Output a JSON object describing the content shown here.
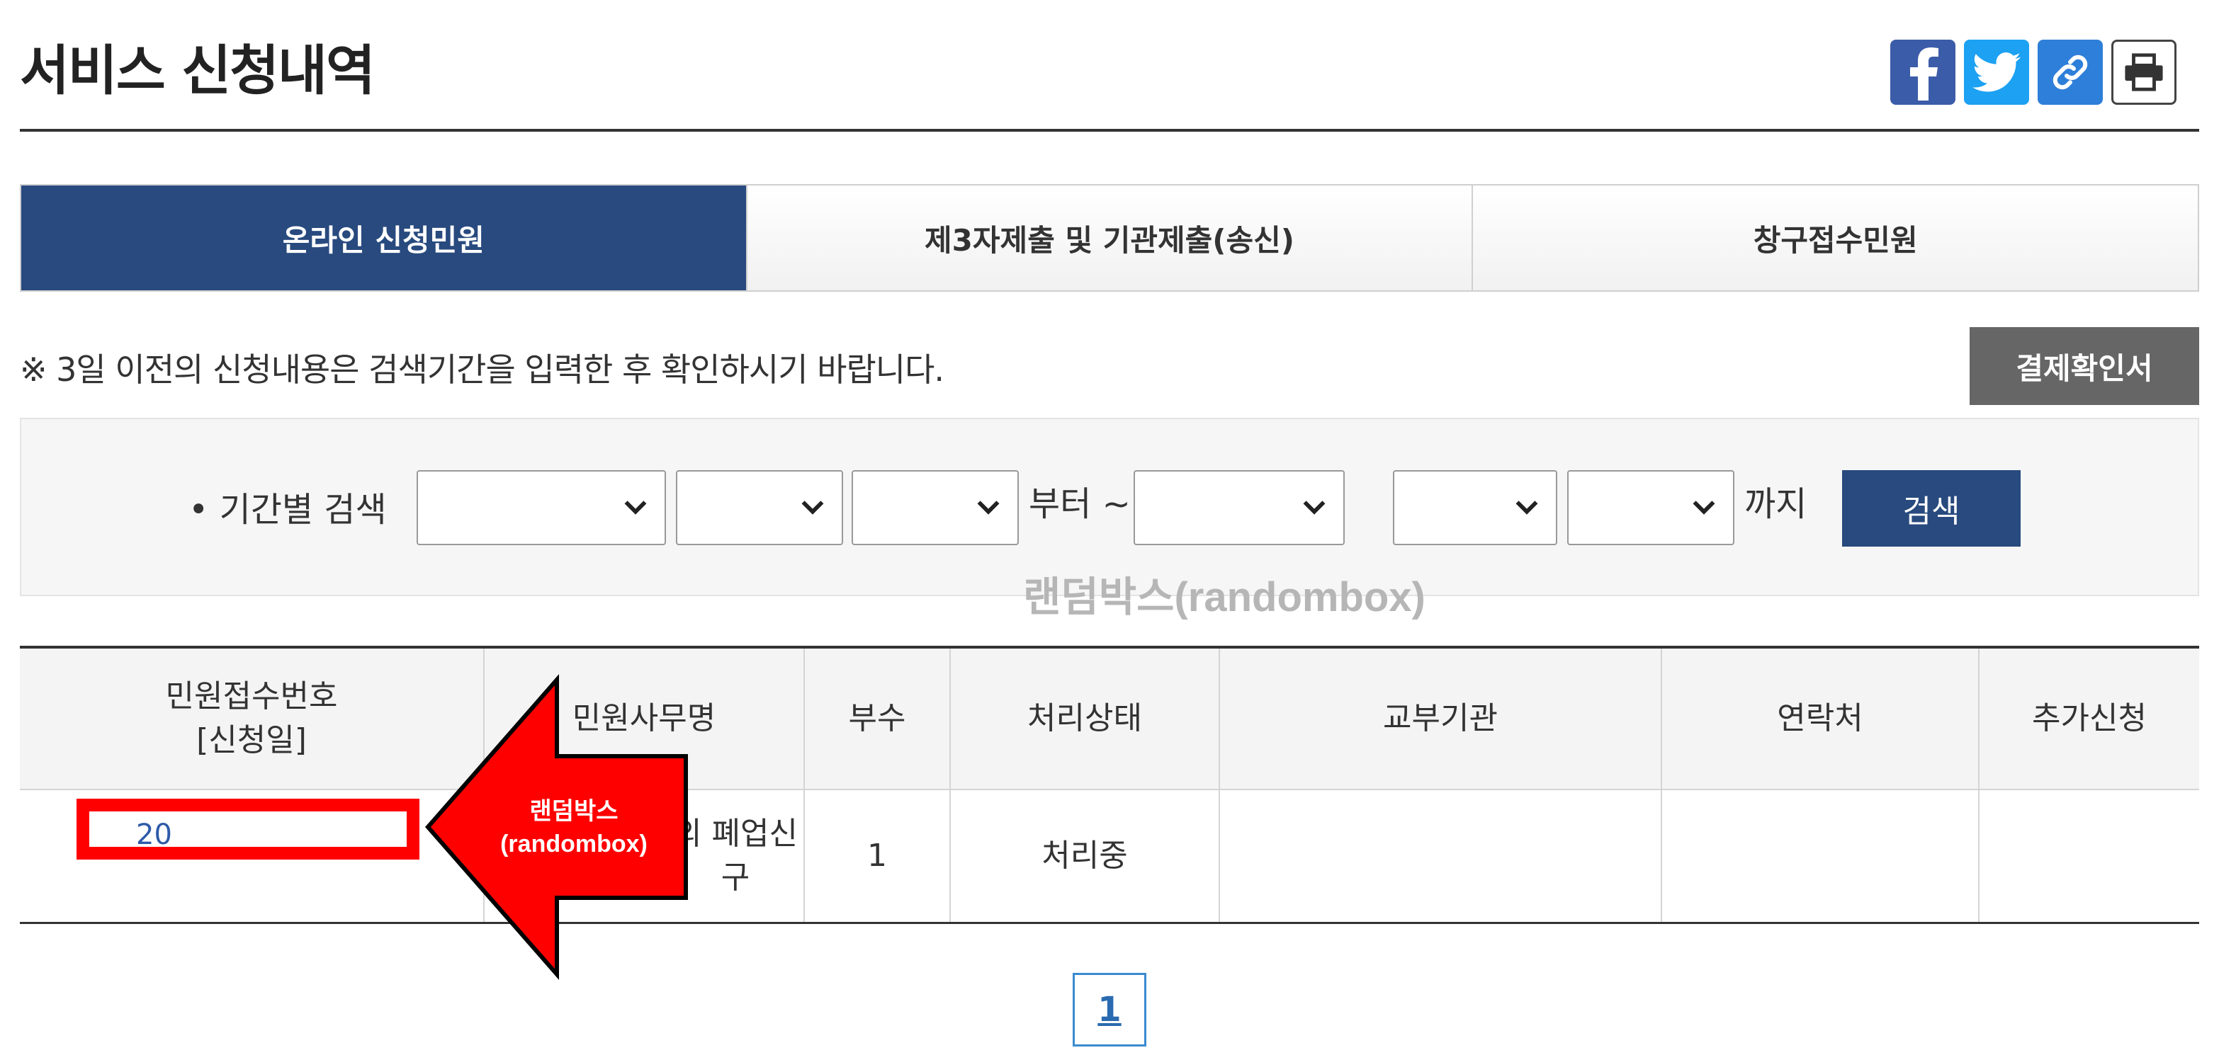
{
  "page": {
    "title": "서비스 신청내역"
  },
  "share": [
    "facebook-icon",
    "twitter-icon",
    "link-icon",
    "print-icon"
  ],
  "tabs": [
    {
      "label": "온라인 신청민원",
      "active": true
    },
    {
      "label": "제3자제출 및 기관제출(송신)",
      "active": false
    },
    {
      "label": "창구접수민원",
      "active": false
    }
  ],
  "notice": "※ 3일 이전의 신청내용은 검색기간을 입력한 후 확인하시기 바랍니다.",
  "receipt_button": "결제확인서",
  "search": {
    "label": "• 기간별 검색",
    "from_word": "부터 ~",
    "to_word": "까지",
    "button": "검색"
  },
  "watermark": "랜덤박스(randombox)",
  "table": {
    "headers": [
      "민원접수번호\n[신청일]",
      "민원사무명",
      "부수",
      "처리상태",
      "교부기관",
      "연락처",
      "추가신청"
    ],
    "rows": [
      {
        "receipt_no": "20",
        "office_name": "의 폐업신\n구",
        "copies": "1",
        "status": "처리중",
        "issuer": "",
        "contact": "",
        "extra": ""
      }
    ]
  },
  "annotation": {
    "label_line1": "랜덤박스",
    "label_line2": "(randombox)"
  },
  "pagination": {
    "current": "1"
  },
  "colors": {
    "primary": "#284a7e",
    "annotation": "#ff0000",
    "muted_button": "#666666"
  }
}
